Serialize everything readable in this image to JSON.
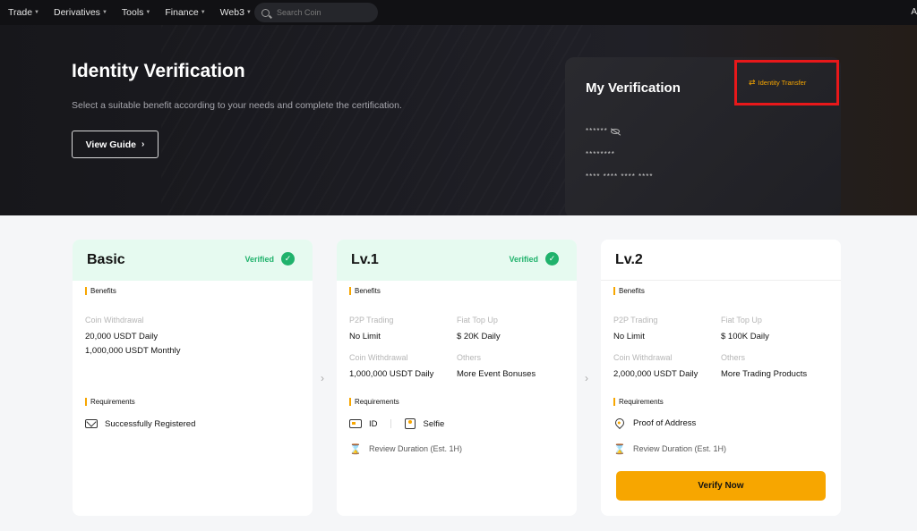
{
  "nav": {
    "items": [
      {
        "label": "Trade"
      },
      {
        "label": "Derivatives"
      },
      {
        "label": "Tools"
      },
      {
        "label": "Finance"
      },
      {
        "label": "Web3"
      }
    ],
    "search_placeholder": "Search Coin",
    "right_label": "A"
  },
  "hero": {
    "title": "Identity Verification",
    "subtitle": "Select a suitable benefit according to your needs and complete the certification.",
    "guide_button": "View Guide"
  },
  "my_verification": {
    "title": "My Verification",
    "transfer_label": "Identity Transfer",
    "masked_name": "******",
    "masked_id": "********",
    "masked_number": "**** **** **** ****"
  },
  "levels": {
    "basic": {
      "title": "Basic",
      "status": "Verified",
      "benefits_label": "Benefits",
      "withdraw_label": "Coin Withdrawal",
      "withdraw_daily": "20,000 USDT Daily",
      "withdraw_monthly": "1,000,000 USDT Monthly",
      "requirements_label": "Requirements",
      "requirement": "Successfully Registered"
    },
    "lv1": {
      "title": "Lv.1",
      "status": "Verified",
      "benefits_label": "Benefits",
      "p2p_label": "P2P Trading",
      "p2p_value": "No Limit",
      "fiat_label": "Fiat Top Up",
      "fiat_value": "$ 20K Daily",
      "withdraw_label": "Coin Withdrawal",
      "withdraw_value": "1,000,000 USDT Daily",
      "others_label": "Others",
      "others_value": "More Event Bonuses",
      "requirements_label": "Requirements",
      "req_id": "ID",
      "req_selfie": "Selfie",
      "review": "Review Duration (Est. 1H)"
    },
    "lv2": {
      "title": "Lv.2",
      "benefits_label": "Benefits",
      "p2p_label": "P2P Trading",
      "p2p_value": "No Limit",
      "fiat_label": "Fiat Top Up",
      "fiat_value": "$ 100K Daily",
      "withdraw_label": "Coin Withdrawal",
      "withdraw_value": "2,000,000 USDT Daily",
      "others_label": "Others",
      "others_value": "More Trading Products",
      "requirements_label": "Requirements",
      "req_address": "Proof of Address",
      "review": "Review Duration (Est. 1H)",
      "verify_button": "Verify Now"
    }
  },
  "colors": {
    "accent": "#f7a600",
    "verified_green": "#20b26c",
    "highlight_red": "#e8181a"
  }
}
